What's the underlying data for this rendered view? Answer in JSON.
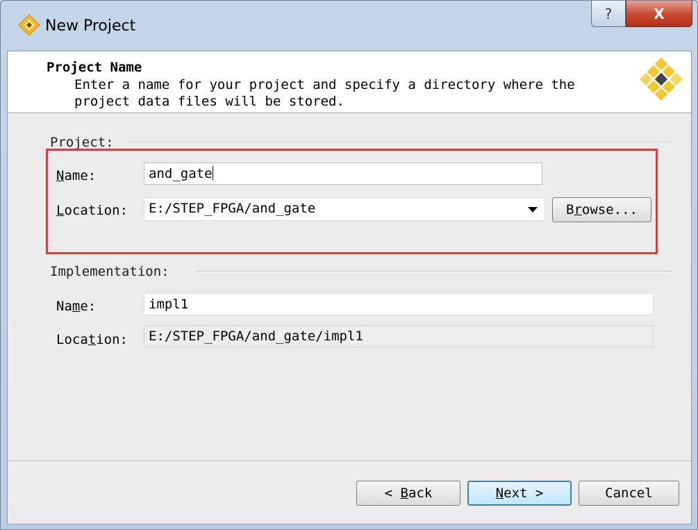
{
  "window": {
    "title": "New Project",
    "icon": "diamond-app-icon",
    "controls": {
      "help": "?",
      "close": "X"
    }
  },
  "header": {
    "title": "Project Name",
    "description": "Enter a name for your project and specify a directory where the project data files will be stored.",
    "logo": "lattice-diamond-logo"
  },
  "project": {
    "group_label": "Project:",
    "name_label": "Name:",
    "name_value": "and_gate",
    "location_label": "Location:",
    "location_value": "E:/STEP_FPGA/and_gate",
    "browse_label": "Browse..."
  },
  "implementation": {
    "group_label": "Implementation:",
    "name_label": "Name:",
    "name_value": "impl1",
    "location_label": "Location:",
    "location_value": "E:/STEP_FPGA/and_gate/impl1"
  },
  "footer": {
    "back_label": "< Back",
    "next_label": "Next >",
    "cancel_label": "Cancel"
  },
  "colors": {
    "highlight_box": "#e8383d",
    "default_button_border": "#3c7fb1"
  }
}
